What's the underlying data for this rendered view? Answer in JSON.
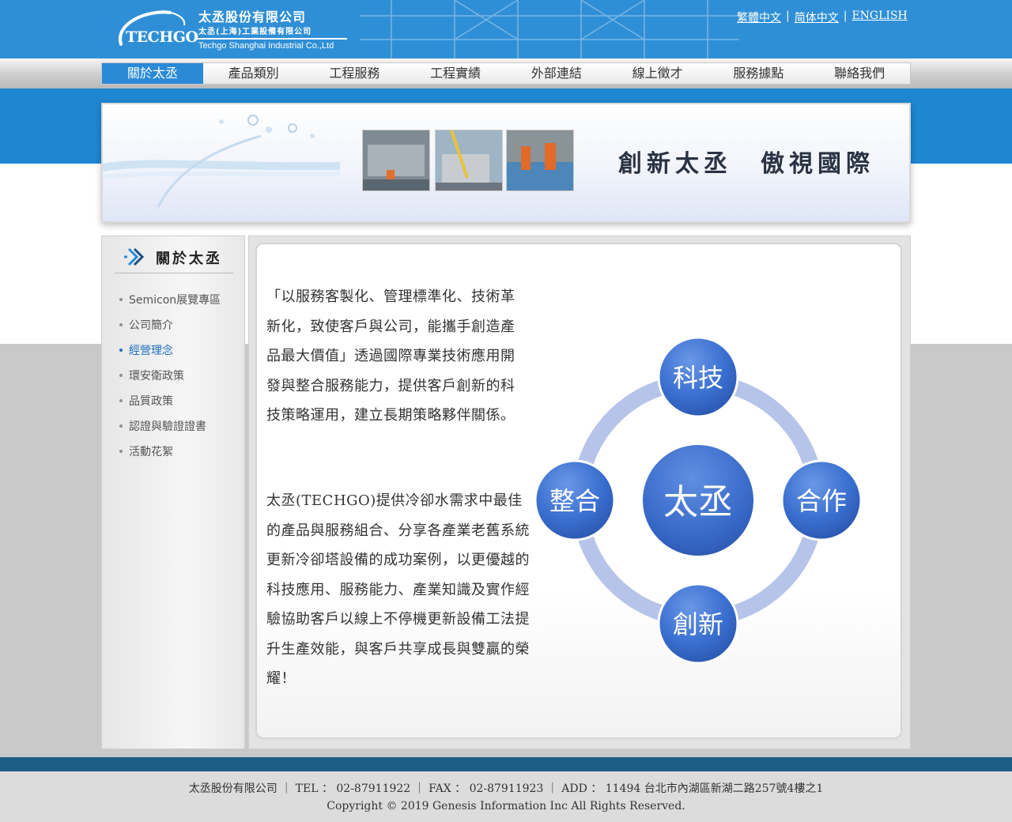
{
  "header": {
    "logo_text": "TECHGO",
    "company_zh": "太丞股份有限公司",
    "company_zh_sub": "太丞(上海)工業設備有限公司",
    "company_en": "Techgo Shanghai Industrial Co.,Ltd",
    "languages": [
      "繁體中文",
      "简体中文",
      "ENGLISH"
    ],
    "lang_separator": "|"
  },
  "nav": {
    "items": [
      "關於太丞",
      "產品類別",
      "工程服務",
      "工程實績",
      "外部連結",
      "線上徵才",
      "服務據點",
      "聯絡我們"
    ],
    "active_index": 0
  },
  "banner": {
    "slogan": "創新太丞　傲視國際"
  },
  "sidebar": {
    "title": "關於太丞",
    "items": [
      "Semicon展覽專區",
      "公司簡介",
      "經營理念",
      "環安衛政策",
      "品質政策",
      "認證與驗證證書",
      "活動花絮"
    ],
    "active_index": 2
  },
  "content": {
    "paragraph1": "「以服務客製化、管理標準化、技術革新化，致使客戶與公司，能攜手創造產品最大價值」透過國際專業技術應用開發與整合服務能力，提供客戶創新的科技策略運用，建立長期策略夥伴關係。",
    "paragraph2": "太丞(TECHGO)提供冷卻水需求中最佳的產品與服務組合、分享各產業老舊系統更新冷卻塔設備的成功案例，以更優越的科技應用、服務能力、產業知識及實作經驗協助客戶以線上不停機更新設備工法提升生產效能，與客戶共享成長與雙贏的榮耀！",
    "diagram": {
      "center": "太丞",
      "top": "科技",
      "right": "合作",
      "bottom": "創新",
      "left": "整合"
    }
  },
  "footer": {
    "info": "太丞股份有限公司 ｜ TEL ： 02-87911922 ｜ FAX ： 02-87911923 ｜ ADD ： 11494 台北市內湖區新湖二路257號4樓之1",
    "copyright": "Copyright © 2019 Genesis Information Inc All Rights Reserved."
  },
  "colors": {
    "header_blue": "#2f8fd6",
    "nav_active": "#2a8ad6",
    "footer_band": "#1d5e86",
    "circle_blue": "#3a6fd0",
    "ring": "#b7c4ea",
    "sidebar_active": "#1f6fbf"
  }
}
